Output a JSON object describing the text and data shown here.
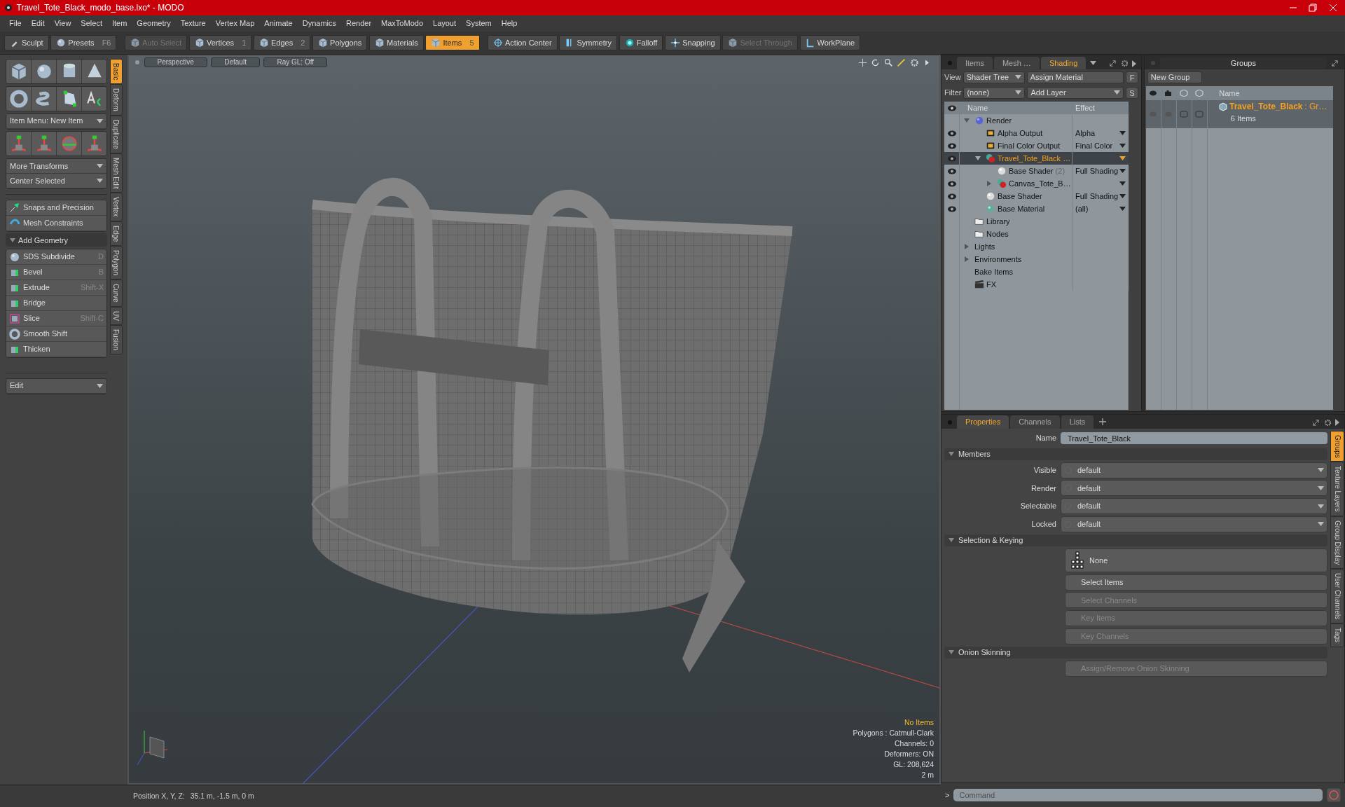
{
  "window": {
    "title": "Travel_Tote_Black_modo_base.lxo* - MODO"
  },
  "menu": [
    "File",
    "Edit",
    "View",
    "Select",
    "Item",
    "Geometry",
    "Texture",
    "Vertex Map",
    "Animate",
    "Dynamics",
    "Render",
    "MaxToModo",
    "Layout",
    "System",
    "Help"
  ],
  "toolbar": [
    {
      "label": "Sculpt",
      "selected": false,
      "disabled": false
    },
    {
      "label": "Presets",
      "shortcut": "F6",
      "selected": false,
      "disabled": false
    },
    {
      "label": "Auto Select",
      "selected": false,
      "disabled": true
    },
    {
      "label": "Vertices",
      "shortcut": "1",
      "selected": false,
      "disabled": false
    },
    {
      "label": "Edges",
      "shortcut": "2",
      "selected": false,
      "disabled": false
    },
    {
      "label": "Polygons",
      "selected": false,
      "disabled": false
    },
    {
      "label": "Materials",
      "selected": false,
      "disabled": false
    },
    {
      "label": "Items",
      "shortcut": "5",
      "selected": true,
      "disabled": false
    },
    {
      "label": "Action Center",
      "selected": false,
      "disabled": false
    },
    {
      "label": "Symmetry",
      "selected": false,
      "disabled": false
    },
    {
      "label": "Falloff",
      "selected": false,
      "disabled": false
    },
    {
      "label": "Snapping",
      "selected": false,
      "disabled": false
    },
    {
      "label": "Select Through",
      "selected": false,
      "disabled": true
    },
    {
      "label": "WorkPlane",
      "selected": false,
      "disabled": false
    }
  ],
  "toolbox": {
    "item_menu": "Item Menu: New Item",
    "transform_menus": [
      "More Transforms",
      "Center Selected"
    ],
    "helpers": [
      {
        "label": "Snaps and Precision"
      },
      {
        "label": "Mesh Constraints"
      }
    ],
    "section": {
      "title": "Add Geometry",
      "expanded": true
    },
    "tools": [
      {
        "label": "SDS Subdivide",
        "shortcut": "D"
      },
      {
        "label": "Bevel",
        "shortcut": "B"
      },
      {
        "label": "Extrude",
        "shortcut": "Shift-X"
      },
      {
        "label": "Bridge"
      },
      {
        "label": "Slice",
        "shortcut": "Shift-C"
      },
      {
        "label": "Smooth Shift"
      },
      {
        "label": "Thicken"
      }
    ],
    "bottom_menu": "Edit"
  },
  "toolbox_tabs": [
    {
      "label": "Basic",
      "selected": true
    },
    {
      "label": "Deform",
      "selected": false
    },
    {
      "label": "Duplicate",
      "selected": false
    },
    {
      "label": "Mesh Edit",
      "selected": false
    },
    {
      "label": "Vertex",
      "selected": false
    },
    {
      "label": "Edge",
      "selected": false
    },
    {
      "label": "Polygon",
      "selected": false
    },
    {
      "label": "Curve",
      "selected": false
    },
    {
      "label": "UV",
      "selected": false
    },
    {
      "label": "Fusion",
      "selected": false
    }
  ],
  "viewport": {
    "header": [
      "Perspective",
      "Default",
      "Ray GL: Off"
    ],
    "info": [
      {
        "text": "No Items",
        "highlight": true
      },
      {
        "text": "Polygons : Catmull-Clark",
        "highlight": false
      },
      {
        "text": "Channels: 0",
        "highlight": false
      },
      {
        "text": "Deformers: ON",
        "highlight": false
      },
      {
        "text": "GL: 208,624",
        "highlight": false
      },
      {
        "text": "2 m",
        "highlight": false
      }
    ]
  },
  "status_bar": {
    "label": "Position X, Y, Z:",
    "value": "35.1 m, -1.5 m, 0 m"
  },
  "shader_panel": {
    "tabs": [
      {
        "label": "Items",
        "selected": false
      },
      {
        "label": "Mesh …",
        "selected": false
      },
      {
        "label": "Shading",
        "selected": true
      }
    ],
    "view_label": "View",
    "view": "Shader Tree",
    "assign": "Assign Material",
    "f_button": "F",
    "filter_label": "Filter",
    "filter": "(none)",
    "add_layer": "Add Layer",
    "s_button": "S",
    "columns": [
      "Name",
      "Effect"
    ],
    "rows": [
      {
        "name": "Render",
        "kind": "render",
        "visible": false,
        "selected": false,
        "expanded": true,
        "children": [
          {
            "name": "Alpha Output",
            "kind": "output",
            "effect": "Alpha",
            "visible": true,
            "selected": false
          },
          {
            "name": "Final Color Output",
            "kind": "output",
            "effect": "Final Color",
            "visible": true,
            "selected": false
          },
          {
            "name": "Travel_Tote_Black …",
            "kind": "material-group",
            "visible": true,
            "selected": true,
            "expanded": true,
            "children": [
              {
                "name": "Base Shader",
                "count": "(2)",
                "kind": "shader",
                "effect": "Full Shading",
                "visible": true,
                "selected": false
              },
              {
                "name": "Canvas_Tote_B…",
                "kind": "material-group",
                "visible": true,
                "selected": false,
                "expanded": false
              }
            ]
          },
          {
            "name": "Base Shader",
            "kind": "shader",
            "effect": "Full Shading",
            "visible": true,
            "selected": false
          },
          {
            "name": "Base Material",
            "kind": "material",
            "effect": "(all)",
            "visible": true,
            "selected": false
          }
        ]
      },
      {
        "name": "Library",
        "kind": "folder",
        "visible": false,
        "selected": false
      },
      {
        "name": "Nodes",
        "kind": "folder",
        "visible": false,
        "selected": false
      },
      {
        "name": "Lights",
        "kind": "plain",
        "visible": false,
        "selected": false,
        "expanded": false
      },
      {
        "name": "Environments",
        "kind": "plain",
        "visible": false,
        "selected": false,
        "expanded": false
      },
      {
        "name": "Bake Items",
        "kind": "plain",
        "visible": false,
        "selected": false
      },
      {
        "name": "FX",
        "kind": "fx",
        "visible": false,
        "selected": false
      }
    ]
  },
  "groups_panel": {
    "title": "Groups",
    "new_group": "New Group",
    "column": "Name",
    "rows": [
      {
        "name": "Travel_Tote_Black",
        "type": ": Gr…",
        "count": "6 Items",
        "selected": true
      }
    ]
  },
  "properties": {
    "tabs": [
      {
        "label": "Properties",
        "selected": true
      },
      {
        "label": "Channels",
        "selected": false
      },
      {
        "label": "Lists",
        "selected": false
      }
    ],
    "name_label": "Name",
    "name_value": "Travel_Tote_Black",
    "sections": [
      {
        "title": "Members",
        "expanded": true,
        "fields": [
          {
            "label": "Visible",
            "value": "default"
          },
          {
            "label": "Render",
            "value": "default"
          },
          {
            "label": "Selectable",
            "value": "default"
          },
          {
            "label": "Locked",
            "value": "default"
          }
        ]
      },
      {
        "title": "Selection & Keying",
        "expanded": true,
        "preset": "None",
        "buttons": [
          {
            "label": "Select Items",
            "disabled": false
          },
          {
            "label": "Select Channels",
            "disabled": true
          },
          {
            "label": "Key Items",
            "disabled": true
          },
          {
            "label": "Key Channels",
            "disabled": true
          }
        ]
      },
      {
        "title": "Onion Skinning",
        "expanded": true,
        "buttons": [
          {
            "label": "Assign/Remove Onion Skinning",
            "disabled": true
          }
        ]
      }
    ],
    "side_tabs": [
      {
        "label": "Groups",
        "selected": true
      },
      {
        "label": "Texture Layers",
        "selected": false
      },
      {
        "label": "Group Display",
        "selected": false
      },
      {
        "label": "User Channels",
        "selected": false
      },
      {
        "label": "Tags",
        "selected": false
      }
    ]
  },
  "command": {
    "prompt": ">",
    "placeholder": "Command"
  }
}
